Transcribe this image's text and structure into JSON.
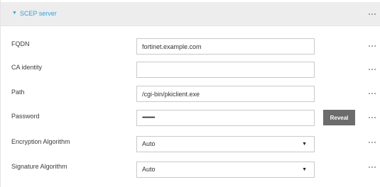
{
  "section": {
    "title": "SCEP server",
    "caret": "▼"
  },
  "fields": {
    "fqdn": {
      "label": "FQDN",
      "value": "fortinet.example.com"
    },
    "ca_identity": {
      "label": "CA identity",
      "value": ""
    },
    "path": {
      "label": "Path",
      "value": "/cgi-bin/pkiclient.exe"
    },
    "password": {
      "label": "Password",
      "value": "••••••••••••"
    },
    "encryption_algorithm": {
      "label": "Encryption Algorithm",
      "selected": "Auto"
    },
    "signature_algorithm": {
      "label": "Signature Algorithm",
      "selected": "Auto"
    }
  },
  "buttons": {
    "reveal": "Reveal"
  },
  "icons": {
    "more": "more-dots-icon",
    "dropdown": "caret-down-icon"
  },
  "colors": {
    "accent": "#2aa7dd",
    "header_bg": "#ededed",
    "reveal_bg": "#6c6c6c"
  }
}
